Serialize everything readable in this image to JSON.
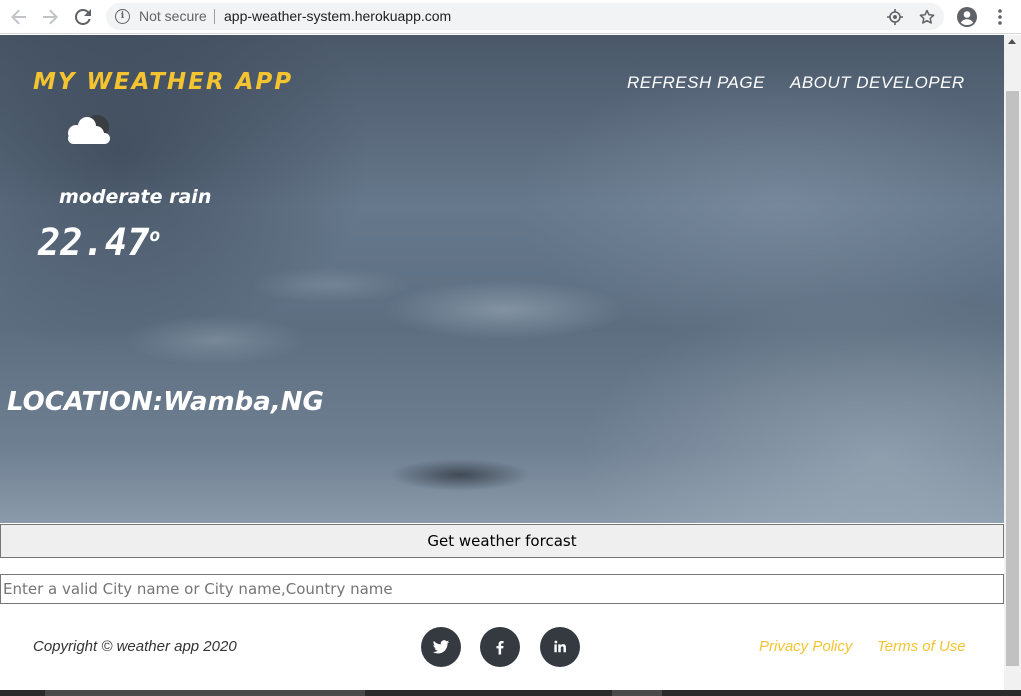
{
  "browser": {
    "security_label": "Not secure",
    "url": "app-weather-system.herokuapp.com",
    "icons": [
      "back-arrow-icon",
      "forward-arrow-icon",
      "reload-icon",
      "info-icon",
      "location-target-icon",
      "star-icon",
      "account-icon",
      "menu-dots-icon"
    ]
  },
  "header": {
    "brand": "MY WEATHER APP",
    "nav": [
      {
        "label": "REFRESH PAGE"
      },
      {
        "label": "ABOUT DEVELOPER"
      }
    ]
  },
  "weather": {
    "icon": "cloud-icon",
    "condition": "moderate rain",
    "temperature": "22.47",
    "degree_symbol": "o",
    "location": "LOCATION:Wamba,NG"
  },
  "form": {
    "button_label": "Get weather forcast",
    "input_placeholder": "Enter a valid City name or City name,Country name",
    "input_value": ""
  },
  "footer": {
    "copyright": "Copyright © weather app 2020",
    "social": [
      "twitter-icon",
      "facebook-icon",
      "linkedin-icon"
    ],
    "links": [
      {
        "label": "Privacy Policy"
      },
      {
        "label": "Terms of Use"
      }
    ]
  },
  "colors": {
    "brand": "#f4c430",
    "footer_links": "#f4c430",
    "social_bg": "#343a40",
    "text_light": "#ffffff"
  }
}
